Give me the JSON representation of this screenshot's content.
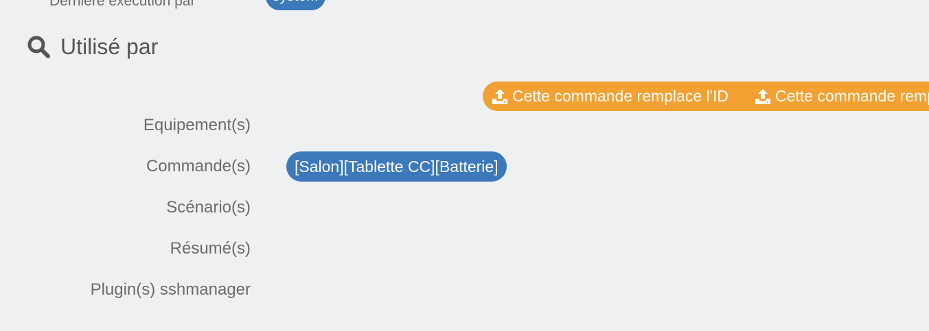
{
  "header": {
    "last_execution_label": "Dernière exécution par",
    "last_execution_value": "system"
  },
  "section": {
    "title": "Utilisé par",
    "icon": "search-icon"
  },
  "replace_badges": [
    {
      "icon": "upload-icon",
      "text": "Cette commande remplace l'ID"
    },
    {
      "icon": "upload-icon",
      "text": "Cette commande remplace l'ID"
    }
  ],
  "rows": [
    {
      "label": "Equipement(s)",
      "values": []
    },
    {
      "label": "Commande(s)",
      "values": [
        "[Salon][Tablette CC][Batterie]"
      ]
    },
    {
      "label": "Scénario(s)",
      "values": []
    },
    {
      "label": "Résumé(s)",
      "values": []
    },
    {
      "label": "Plugin(s) sshmanager",
      "values": []
    }
  ],
  "colors": {
    "background": "#eff0f2",
    "badge_blue": "#3b79bb",
    "badge_orange": "#f2a132",
    "label_text": "#6b6b6b"
  }
}
